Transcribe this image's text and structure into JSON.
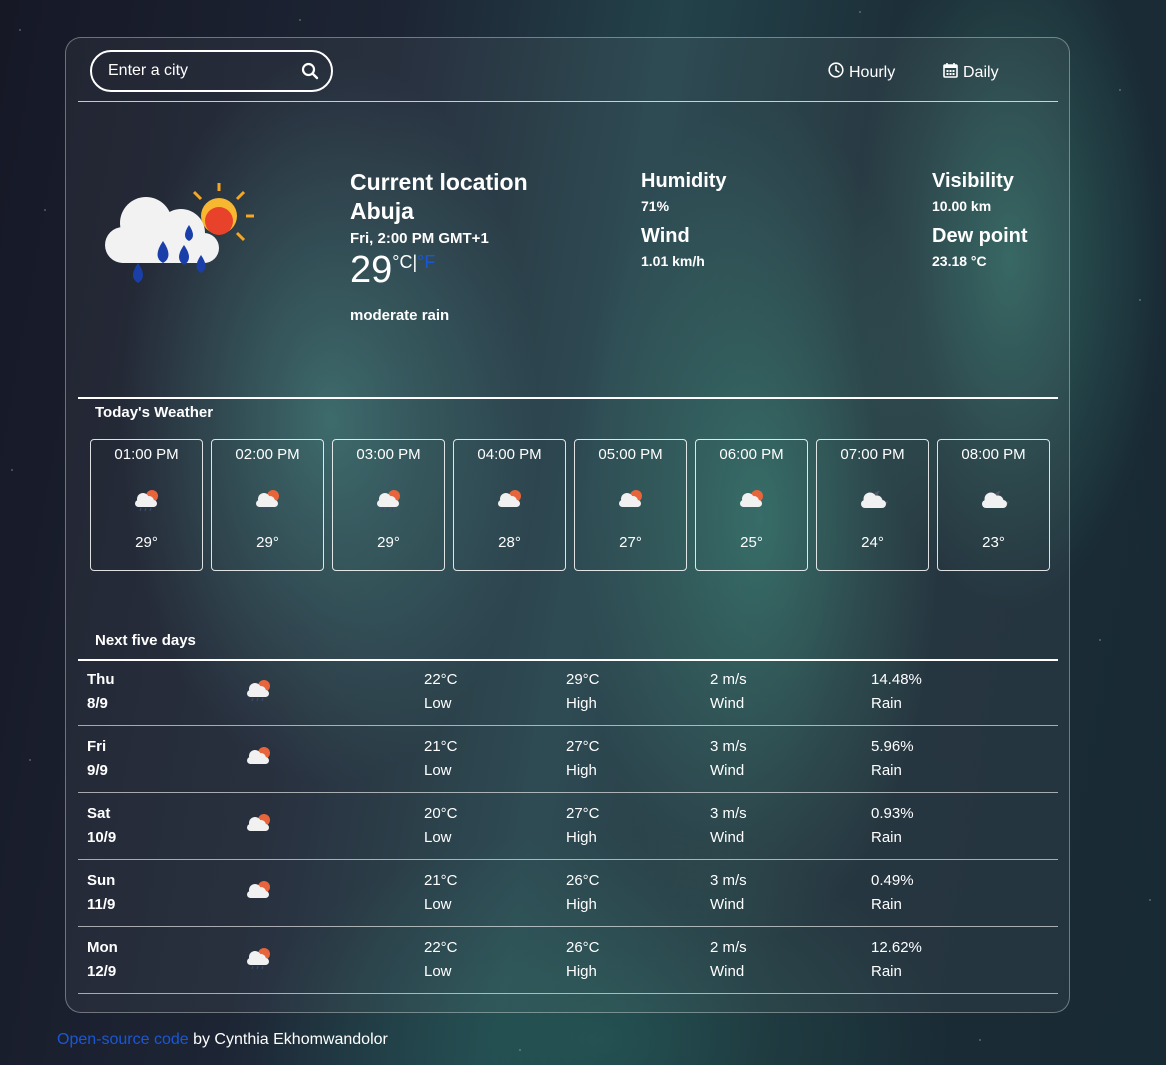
{
  "search": {
    "placeholder": "Enter a city"
  },
  "nav": {
    "hourly": "Hourly",
    "daily": "Daily"
  },
  "current": {
    "heading": "Current location",
    "city": "Abuja",
    "datetime": "Fri, 2:00 PM GMT+1",
    "temp": "29",
    "unit_c": "°C",
    "unit_sep": "|",
    "unit_f": "°F",
    "description": "moderate rain",
    "icon": "rain-cloud-sun-icon"
  },
  "stats": {
    "humidity_label": "Humidity",
    "humidity": "71%",
    "wind_label": "Wind",
    "wind": "1.01 km/h",
    "visibility_label": "Visibility",
    "visibility": "10.00 km",
    "dew_label": "Dew point",
    "dew": "23.18 °C"
  },
  "today_title": "Today's Weather",
  "hours": [
    {
      "time": "01:00 PM",
      "temp": "29°",
      "icon": "rain-cloud-sun-icon"
    },
    {
      "time": "02:00 PM",
      "temp": "29°",
      "icon": "rain-cloud-sun-icon"
    },
    {
      "time": "03:00 PM",
      "temp": "29°",
      "icon": "rain-cloud-sun-icon"
    },
    {
      "time": "04:00 PM",
      "temp": "28°",
      "icon": "cloud-sun-icon"
    },
    {
      "time": "05:00 PM",
      "temp": "27°",
      "icon": "cloud-sun-icon"
    },
    {
      "time": "06:00 PM",
      "temp": "25°",
      "icon": "cloud-sun-icon"
    },
    {
      "time": "07:00 PM",
      "temp": "24°",
      "icon": "cloud-moon-icon"
    },
    {
      "time": "08:00 PM",
      "temp": "23°",
      "icon": "cloud-moon-icon"
    }
  ],
  "days_title": "Next five days",
  "days": [
    {
      "day": "Thu",
      "date": "8/9",
      "low": "22°C",
      "low_label": "Low",
      "high": "29°C",
      "high_label": "High",
      "wind": "2 m/s",
      "wind_label": "Wind",
      "rain": "14.48%",
      "rain_label": "Rain",
      "icon": "rain-cloud-sun-icon"
    },
    {
      "day": "Fri",
      "date": "9/9",
      "low": "21°C",
      "low_label": "Low",
      "high": "27°C",
      "high_label": "High",
      "wind": "3 m/s",
      "wind_label": "Wind",
      "rain": "5.96%",
      "rain_label": "Rain",
      "icon": "cloud-sun-icon"
    },
    {
      "day": "Sat",
      "date": "10/9",
      "low": "20°C",
      "low_label": "Low",
      "high": "27°C",
      "high_label": "High",
      "wind": "3 m/s",
      "wind_label": "Wind",
      "rain": "0.93%",
      "rain_label": "Rain",
      "icon": "cloud-sun-icon"
    },
    {
      "day": "Sun",
      "date": "11/9",
      "low": "21°C",
      "low_label": "Low",
      "high": "26°C",
      "high_label": "High",
      "wind": "3 m/s",
      "wind_label": "Wind",
      "rain": "0.49%",
      "rain_label": "Rain",
      "icon": "cloud-sun-icon"
    },
    {
      "day": "Mon",
      "date": "12/9",
      "low": "22°C",
      "low_label": "Low",
      "high": "26°C",
      "high_label": "High",
      "wind": "2 m/s",
      "wind_label": "Wind",
      "rain": "12.62%",
      "rain_label": "Rain",
      "icon": "rain-cloud-sun-icon"
    }
  ],
  "footer": {
    "link": "Open-source code",
    "text": " by Cynthia Ekhomwandolor"
  },
  "colors": {
    "accent": "#1a57d6",
    "sun": "#f5a623",
    "rain": "#1b3fa8"
  }
}
